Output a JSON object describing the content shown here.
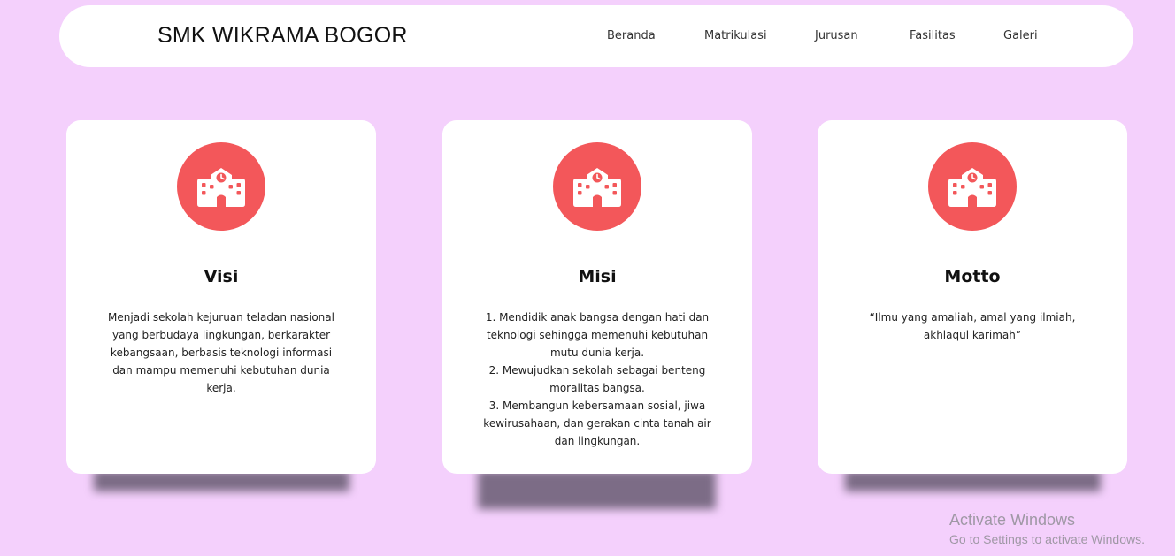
{
  "navbar": {
    "brand": "SMK WIKRAMA BOGOR",
    "links": [
      "Beranda",
      "Matrikulasi",
      "Jurusan",
      "Fasilitas",
      "Galeri"
    ]
  },
  "cards": [
    {
      "icon": "school-icon",
      "title": "Visi",
      "lines": [
        "Menjadi sekolah kejuruan teladan nasional",
        "yang berbudaya lingkungan, berkarakter",
        "kebangsaan, berbasis teknologi informasi",
        "dan mampu memenuhi kebutuhan dunia",
        "kerja."
      ]
    },
    {
      "icon": "school-icon",
      "title": "Misi",
      "lines": [
        "1. Mendidik anak bangsa dengan hati dan",
        "teknologi sehingga memenuhi kebutuhan",
        "mutu dunia kerja.",
        "2. Mewujudkan sekolah sebagai benteng",
        "moralitas bangsa.",
        "3. Membangun kebersamaan sosial, jiwa",
        "kewirusahaan, dan gerakan cinta tanah air",
        "dan lingkungan."
      ]
    },
    {
      "icon": "school-icon",
      "title": "Motto",
      "lines": [
        "“Ilmu yang amaliah, amal yang ilmiah,",
        "akhlaqul karimah”"
      ]
    }
  ],
  "colors": {
    "page_background": "#f4d0fc",
    "icon_circle": "#f3575a",
    "card_background": "#ffffff"
  },
  "watermark": {
    "title": "Activate Windows",
    "subtitle": "Go to Settings to activate Windows."
  }
}
